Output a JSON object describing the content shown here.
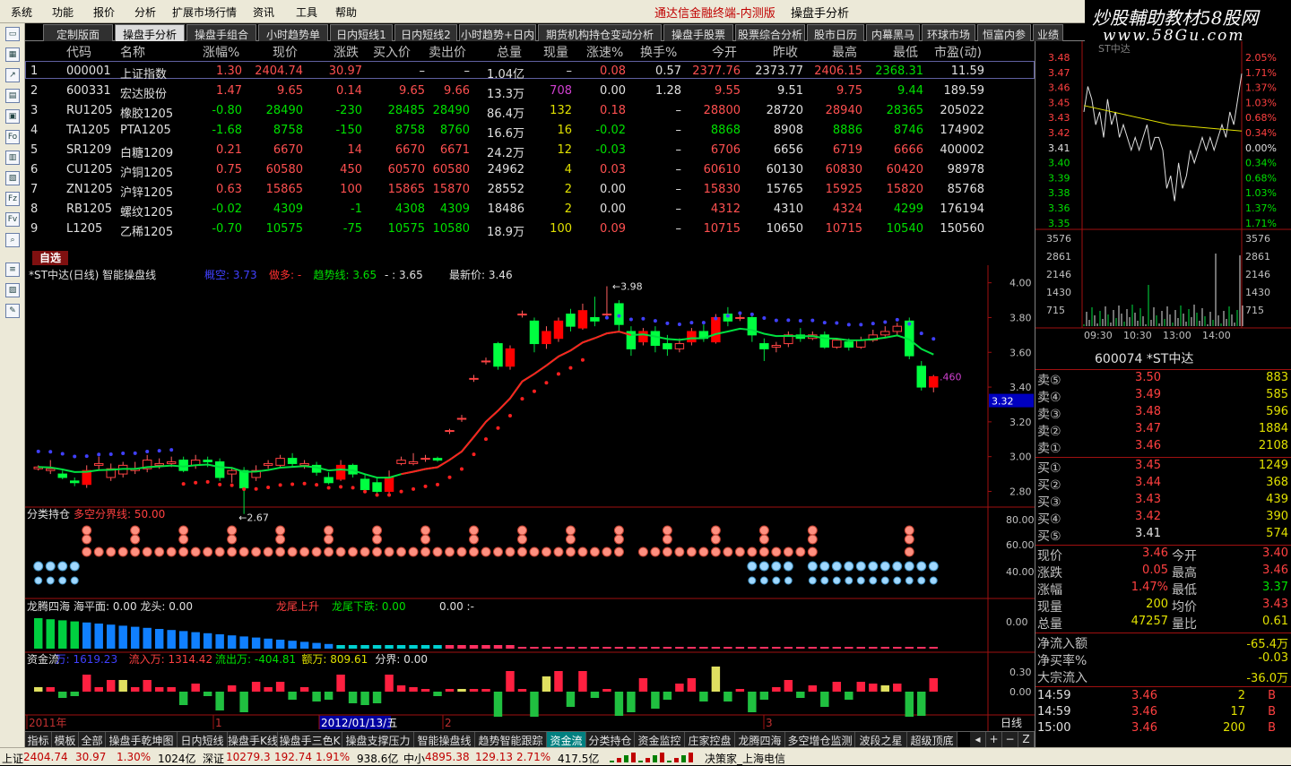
{
  "menu": [
    "系统",
    "功能",
    "报价",
    "分析",
    "扩展市场行情",
    "资讯",
    "工具",
    "帮助"
  ],
  "app_title": "通达信金融终端-内测版",
  "app_subtitle": "操盘手分析",
  "watermark": {
    "line1": "炒股輔助教材58股网",
    "line2": "www.58Gu.com"
  },
  "tabs": [
    "定制版面",
    "操盘手分析",
    "操盘手组合",
    "小时趋势单",
    "日内短线1",
    "日内短线2",
    "小时趋势+日内",
    "期货机构持仓变动分析",
    "操盘手股票",
    "股票综合分析",
    "股市日历",
    "内幕黑马",
    "环球市场",
    "恒富内参",
    "业绩"
  ],
  "active_tab": 1,
  "quote_headers": [
    "代码",
    "名称",
    "涨幅%",
    "现价",
    "涨跌",
    "买入价",
    "卖出价",
    "总量",
    "现量",
    "涨速%",
    "换手%",
    "今开",
    "昨收",
    "最高",
    "最低",
    "市盈(动)"
  ],
  "quote_rows": [
    [
      "1",
      "000001",
      "上证指数",
      "1.30",
      "2404.74",
      "30.97",
      "–",
      "–",
      "1.04亿",
      "–",
      "0.08",
      "0.57",
      "2377.76",
      "2373.77",
      "2406.15",
      "2368.31",
      "11.59"
    ],
    [
      "2",
      "600331",
      "宏达股份",
      "1.47",
      "9.65",
      "0.14",
      "9.65",
      "9.66",
      "13.3万",
      "708",
      "0.00",
      "1.28",
      "9.55",
      "9.51",
      "9.75",
      "9.44",
      "189.59"
    ],
    [
      "3",
      "RU1205",
      "橡胶1205",
      "-0.80",
      "28490",
      "-230",
      "28485",
      "28490",
      "86.4万",
      "132",
      "0.18",
      "–",
      "28800",
      "28720",
      "28940",
      "28365",
      "205022"
    ],
    [
      "4",
      "TA1205",
      "PTA1205",
      "-1.68",
      "8758",
      "-150",
      "8758",
      "8760",
      "16.6万",
      "16",
      "-0.02",
      "–",
      "8868",
      "8908",
      "8886",
      "8746",
      "174902"
    ],
    [
      "5",
      "SR1209",
      "白糖1209",
      "0.21",
      "6670",
      "14",
      "6670",
      "6671",
      "24.2万",
      "12",
      "-0.03",
      "–",
      "6706",
      "6656",
      "6719",
      "6666",
      "400002"
    ],
    [
      "6",
      "CU1205",
      "沪铜1205",
      "0.75",
      "60580",
      "450",
      "60570",
      "60580",
      "24962",
      "4",
      "0.03",
      "–",
      "60610",
      "60130",
      "60830",
      "60420",
      "98978"
    ],
    [
      "7",
      "ZN1205",
      "沪锌1205",
      "0.63",
      "15865",
      "100",
      "15865",
      "15870",
      "28552",
      "2",
      "0.00",
      "–",
      "15830",
      "15765",
      "15925",
      "15820",
      "85768"
    ],
    [
      "8",
      "RB1205",
      "螺纹1205",
      "-0.02",
      "4309",
      "-1",
      "4308",
      "4309",
      "18486",
      "2",
      "0.00",
      "–",
      "4312",
      "4310",
      "4324",
      "4299",
      "176194"
    ],
    [
      "9",
      "L1205",
      "乙稀1205",
      "-0.70",
      "10575",
      "-75",
      "10575",
      "10580",
      "18.9万",
      "100",
      "0.09",
      "–",
      "10715",
      "10650",
      "10715",
      "10540",
      "150560"
    ]
  ],
  "zixuan": "自选",
  "main_chart": {
    "title": "*ST中达(日线) 智能操盘线",
    "legend": [
      {
        "t": "概空: 3.73",
        "c": "#4040ff"
      },
      {
        "t": "做多: -",
        "c": "#ff3030"
      },
      {
        "t": "趋势线: 3.65",
        "c": "#00e000"
      },
      {
        "t": "- : 3.65",
        "c": "#e0e0e0"
      },
      {
        "t": "最新价: 3.46",
        "c": "#e0e0e0"
      }
    ],
    "y_ticks": [
      "4.00",
      "3.80",
      "3.60",
      "3.40",
      "3.20",
      "3.00",
      "2.80"
    ],
    "ylim": [
      2.72,
      4.06
    ],
    "high_label": "3.98",
    "low_label": "2.67",
    "last_label": ".460",
    "cursor_price": "3.32",
    "candles": [
      [
        2.93,
        2.94,
        2.95,
        2.92
      ],
      [
        2.92,
        2.93,
        2.98,
        2.9
      ],
      [
        2.9,
        2.88,
        2.92,
        2.87
      ],
      [
        2.86,
        2.85,
        2.88,
        2.83
      ],
      [
        2.84,
        2.92,
        2.95,
        2.82
      ],
      [
        2.95,
        2.96,
        3.0,
        2.92
      ],
      [
        2.88,
        2.93,
        2.96,
        2.86
      ],
      [
        2.9,
        2.95,
        2.97,
        2.88
      ],
      [
        2.92,
        2.93,
        2.97,
        2.9
      ],
      [
        2.93,
        2.98,
        3.01,
        2.91
      ],
      [
        2.95,
        2.96,
        2.99,
        2.93
      ],
      [
        2.96,
        2.97,
        3.0,
        2.94
      ],
      [
        2.98,
        2.92,
        3.0,
        2.91
      ],
      [
        2.95,
        2.98,
        3.01,
        2.93
      ],
      [
        2.98,
        2.97,
        3.0,
        2.94
      ],
      [
        2.97,
        2.88,
        2.99,
        2.86
      ],
      [
        2.9,
        2.92,
        2.94,
        2.85
      ],
      [
        2.92,
        2.82,
        2.94,
        2.67
      ],
      [
        2.88,
        2.92,
        2.95,
        2.86
      ],
      [
        2.95,
        2.96,
        2.98,
        2.93
      ],
      [
        2.95,
        2.99,
        3.01,
        2.94
      ],
      [
        2.99,
        2.96,
        3.02,
        2.94
      ],
      [
        2.95,
        2.96,
        2.98,
        2.93
      ],
      [
        2.95,
        2.91,
        2.97,
        2.89
      ],
      [
        2.88,
        2.85,
        2.91,
        2.84
      ],
      [
        2.87,
        2.95,
        2.98,
        2.86
      ],
      [
        2.95,
        2.9,
        2.96,
        2.88
      ],
      [
        2.87,
        2.81,
        2.9,
        2.8
      ],
      [
        2.85,
        2.8,
        2.88,
        2.78
      ],
      [
        2.8,
        2.88,
        2.92,
        2.79
      ],
      [
        2.96,
        2.98,
        3.0,
        2.95
      ],
      [
        2.96,
        2.97,
        3.02,
        2.95
      ],
      [
        2.99,
        2.99,
        3.01,
        2.97
      ],
      [
        2.99,
        2.98,
        3.0,
        2.97
      ],
      [
        3.15,
        3.15,
        3.16,
        3.13
      ],
      [
        3.22,
        3.22,
        3.24,
        3.2
      ],
      [
        3.45,
        3.45,
        3.47,
        3.43
      ],
      [
        3.55,
        3.55,
        3.57,
        3.53
      ],
      [
        3.65,
        3.52,
        3.66,
        3.5
      ],
      [
        3.52,
        3.62,
        3.64,
        3.5
      ],
      [
        3.82,
        3.82,
        3.84,
        3.8
      ],
      [
        3.78,
        3.65,
        3.8,
        3.6
      ],
      [
        3.65,
        3.72,
        3.75,
        3.62
      ],
      [
        3.68,
        3.78,
        3.8,
        3.66
      ],
      [
        3.82,
        3.75,
        3.85,
        3.72
      ],
      [
        3.74,
        3.84,
        3.88,
        3.73
      ],
      [
        3.8,
        3.78,
        3.92,
        3.75
      ],
      [
        3.82,
        3.82,
        3.98,
        3.8
      ],
      [
        3.88,
        3.76,
        3.9,
        3.72
      ],
      [
        3.72,
        3.62,
        3.75,
        3.58
      ],
      [
        3.66,
        3.72,
        3.74,
        3.64
      ],
      [
        3.72,
        3.64,
        3.75,
        3.6
      ],
      [
        3.65,
        3.62,
        3.7,
        3.58
      ],
      [
        3.62,
        3.65,
        3.68,
        3.6
      ],
      [
        3.66,
        3.72,
        3.74,
        3.64
      ],
      [
        3.72,
        3.68,
        3.76,
        3.66
      ],
      [
        3.66,
        3.8,
        3.82,
        3.65
      ],
      [
        3.82,
        3.78,
        3.86,
        3.75
      ],
      [
        3.8,
        3.8,
        3.82,
        3.78
      ],
      [
        3.8,
        3.7,
        3.82,
        3.66
      ],
      [
        3.65,
        3.62,
        3.68,
        3.55
      ],
      [
        3.63,
        3.64,
        3.66,
        3.6
      ],
      [
        3.65,
        3.7,
        3.72,
        3.63
      ],
      [
        3.7,
        3.68,
        3.74,
        3.66
      ],
      [
        3.68,
        3.7,
        3.72,
        3.67
      ],
      [
        3.7,
        3.63,
        3.72,
        3.62
      ],
      [
        3.63,
        3.67,
        3.68,
        3.62
      ],
      [
        3.66,
        3.63,
        3.68,
        3.61
      ],
      [
        3.63,
        3.67,
        3.69,
        3.62
      ],
      [
        3.67,
        3.7,
        3.73,
        3.66
      ],
      [
        3.7,
        3.72,
        3.75,
        3.69
      ],
      [
        3.72,
        3.75,
        3.77,
        3.7
      ],
      [
        3.78,
        3.58,
        3.8,
        3.56
      ],
      [
        3.52,
        3.4,
        3.55,
        3.38
      ],
      [
        3.4,
        3.46,
        3.47,
        3.37
      ]
    ]
  },
  "fenlei": {
    "title": "分类持仓",
    "sub": "多空分界线: 50.00",
    "y_ticks": [
      "80.00",
      "60.00",
      "40.00"
    ]
  },
  "longteng": {
    "title": "龙腾四海",
    "params": "海平面: 0.00 龙头: 0.00",
    "rise": "龙尾上升",
    "fall": "龙尾下跌: 0.00",
    "end": "0.00 :-",
    "y_tick": "0.00"
  },
  "zijin": {
    "title": "资金流",
    "wan": "万: 1619.23",
    "in": "流入万: 1314.42",
    "out": "流出万: -404.81",
    "e": "额万: 809.61",
    "fenjie": "分界: 0.00",
    "y_ticks": [
      "0.30",
      "0.00"
    ]
  },
  "x_axis": {
    "labels": [
      "2011年",
      "1",
      "2012/01/13/五",
      "2",
      "3"
    ],
    "period": "日线"
  },
  "bottom_tabs": [
    "指标",
    "模板",
    "全部",
    "操盘手乾坤图",
    "日内短线",
    "操盘手K线",
    "操盘手三色K",
    "操盘支撑压力",
    "智能操盘线",
    "趋势智能跟踪",
    "资金流",
    "分类持仓",
    "资金监控",
    "庄家控盘",
    "龙腾四海",
    "多空增仓监测",
    "波段之星",
    "超级顶底"
  ],
  "active_bottom_tab": 10,
  "right": {
    "intraday_y_left": [
      "3.48",
      "3.47",
      "3.46",
      "3.45",
      "3.43",
      "3.42",
      "3.41",
      "3.40",
      "3.39",
      "3.38",
      "3.36",
      "3.35"
    ],
    "intraday_y_right": [
      "2.05%",
      "1.71%",
      "1.37%",
      "1.03%",
      "0.68%",
      "0.34%",
      "0.00%",
      "0.34%",
      "0.68%",
      "1.03%",
      "1.37%",
      "1.71%"
    ],
    "vol_ticks": [
      "3576",
      "2861",
      "2146",
      "1430",
      "715"
    ],
    "time_ticks": [
      "09:30",
      "10:30",
      "13:00",
      "14:00"
    ],
    "intraday_title": "ST中达",
    "stock": "600074 *ST中达",
    "sell": [
      [
        "卖⑤",
        "3.50",
        "883"
      ],
      [
        "卖④",
        "3.49",
        "585"
      ],
      [
        "卖③",
        "3.48",
        "596"
      ],
      [
        "卖②",
        "3.47",
        "1884"
      ],
      [
        "卖①",
        "3.46",
        "2108"
      ]
    ],
    "buy": [
      [
        "买①",
        "3.45",
        "1249"
      ],
      [
        "买②",
        "3.44",
        "368"
      ],
      [
        "买③",
        "3.43",
        "439"
      ],
      [
        "买④",
        "3.42",
        "390"
      ],
      [
        "买⑤",
        "3.41",
        "574"
      ]
    ],
    "info": [
      [
        "现价",
        "3.46",
        "今开",
        "3.40"
      ],
      [
        "涨跌",
        "0.05",
        "最高",
        "3.46"
      ],
      [
        "涨幅",
        "1.47%",
        "最低",
        "3.37"
      ],
      [
        "现量",
        "200",
        "均价",
        "3.43"
      ],
      [
        "总量",
        "47257",
        "量比",
        "0.61"
      ]
    ],
    "flow": [
      [
        "净流入额",
        "-65.4万"
      ],
      [
        "净买率%",
        "-0.03"
      ],
      [
        "大宗流入",
        "-36.0万"
      ]
    ],
    "ticks": [
      [
        "14:59",
        "3.46",
        "2",
        "B"
      ],
      [
        "14:59",
        "3.46",
        "17",
        "B"
      ],
      [
        "15:00",
        "3.46",
        "200",
        "B"
      ]
    ]
  },
  "status": {
    "sh": "上证",
    "sh_v": "2404.74",
    "sh_c": "30.97",
    "sh_p": "1.30%",
    "sh_a": "1024亿",
    "sz": "深证",
    "sz_v": "10279.3",
    "sz_c": "192.74",
    "sz_p": "1.91%",
    "sz_a": "938.6亿",
    "zx": "中小",
    "zx_v": "4895.38",
    "zx_c": "129.13",
    "zx_p": "2.71%",
    "zx_a": "417.5亿",
    "note": "决策家_上海电信"
  }
}
